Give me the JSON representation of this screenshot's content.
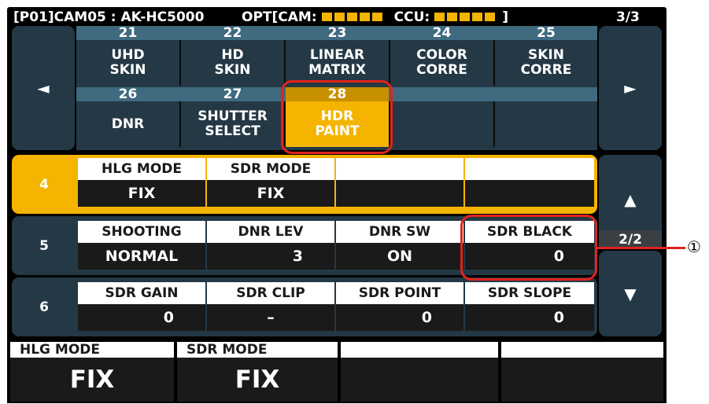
{
  "header": {
    "camera_label": "[P01]CAM05 : AK-HC5000",
    "opt_label": "OPT[CAM:",
    "ccu_label": "CCU:",
    "bracket_close": "]",
    "page_indicator": "3/3",
    "level_color": "#f4b400"
  },
  "menu": {
    "prev_icon": "◄",
    "next_icon": "►",
    "items": [
      {
        "num": "21",
        "label": "UHD\nSKIN"
      },
      {
        "num": "22",
        "label": "HD\nSKIN"
      },
      {
        "num": "23",
        "label": "LINEAR\nMATRIX"
      },
      {
        "num": "24",
        "label": "COLOR\nCORRE"
      },
      {
        "num": "25",
        "label": "SKIN\nCORRE"
      },
      {
        "num": "26",
        "label": "DNR"
      },
      {
        "num": "27",
        "label": "SHUTTER\nSELECT"
      },
      {
        "num": "28",
        "label": "HDR\nPAINT",
        "active": true
      }
    ]
  },
  "params": {
    "rows": [
      {
        "num": "4",
        "active": true,
        "cells": [
          {
            "head": "HLG MODE",
            "value": "FIX"
          },
          {
            "head": "SDR MODE",
            "value": "FIX"
          },
          {
            "head": "",
            "value": ""
          },
          {
            "head": "",
            "value": ""
          }
        ]
      },
      {
        "num": "5",
        "cells": [
          {
            "head": "SHOOTING",
            "value": "NORMAL"
          },
          {
            "head": "DNR LEV",
            "value": "3"
          },
          {
            "head": "DNR SW",
            "value": "ON"
          },
          {
            "head": "SDR BLACK",
            "value": "0"
          }
        ]
      },
      {
        "num": "6",
        "cells": [
          {
            "head": "SDR GAIN",
            "value": "0"
          },
          {
            "head": "SDR CLIP",
            "value": "–"
          },
          {
            "head": "SDR POINT",
            "value": "0"
          },
          {
            "head": "SDR SLOPE",
            "value": "0"
          }
        ]
      }
    ],
    "up_icon": "▲",
    "down_icon": "▼",
    "page_indicator": "2/2"
  },
  "bottom": {
    "cells": [
      {
        "head": "HLG MODE",
        "value": "FIX"
      },
      {
        "head": "SDR MODE",
        "value": "FIX"
      },
      {
        "head": "",
        "value": ""
      },
      {
        "head": "",
        "value": ""
      }
    ]
  },
  "callout": {
    "label": "①",
    "accent": "#e0231c"
  }
}
